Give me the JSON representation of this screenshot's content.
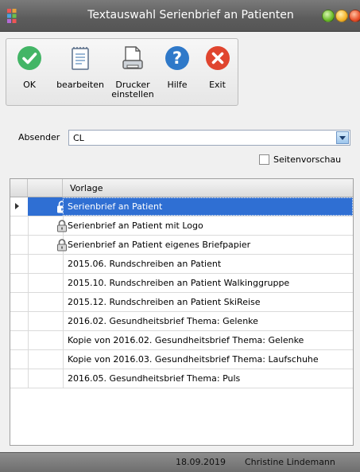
{
  "window": {
    "title": "Textauswahl Serienbrief an Patienten"
  },
  "toolbar": {
    "ok_label": "OK",
    "edit_label": "bearbeiten",
    "printer_label": "Drucker\neinstellen",
    "help_label": "Hilfe",
    "exit_label": "Exit"
  },
  "form": {
    "sender_label": "Absender",
    "sender_value": "CL",
    "preview_label": "Seitenvorschau",
    "preview_checked": false
  },
  "grid": {
    "column_header": "Vorlage",
    "rows": [
      {
        "label": "Serienbrief an Patient",
        "locked": true,
        "selected": true
      },
      {
        "label": "Serienbrief an Patient mit Logo",
        "locked": true,
        "selected": false
      },
      {
        "label": "Serienbrief an Patient eigenes Briefpapier",
        "locked": true,
        "selected": false
      },
      {
        "label": "2015.06. Rundschreiben an Patient",
        "locked": false,
        "selected": false
      },
      {
        "label": "2015.10. Rundschreiben an Patient Walkinggruppe",
        "locked": false,
        "selected": false
      },
      {
        "label": "2015.12. Rundschreiben an Patient SkiReise",
        "locked": false,
        "selected": false
      },
      {
        "label": "2016.02. Gesundheitsbrief Thema: Gelenke",
        "locked": false,
        "selected": false
      },
      {
        "label": "Kopie von 2016.02. Gesundheitsbrief Thema: Gelenke",
        "locked": false,
        "selected": false
      },
      {
        "label": "Kopie von 2016.03. Gesundheitsbrief Thema: Laufschuhe",
        "locked": false,
        "selected": false
      },
      {
        "label": "2016.05. Gesundheitsbrief Thema: Puls",
        "locked": false,
        "selected": false
      }
    ]
  },
  "status": {
    "date": "18.09.2019",
    "user": "Christine Lindemann"
  },
  "icons": {
    "ok": "check-circle-icon",
    "edit": "notepad-icon",
    "printer": "printer-icon",
    "help": "question-mark-icon",
    "exit": "close-circle-icon",
    "lock": "padlock-icon"
  },
  "colors": {
    "selection": "#2f6fd3",
    "ok_green": "#43b566",
    "help_blue": "#2f79c9",
    "exit_red": "#e0452f"
  }
}
